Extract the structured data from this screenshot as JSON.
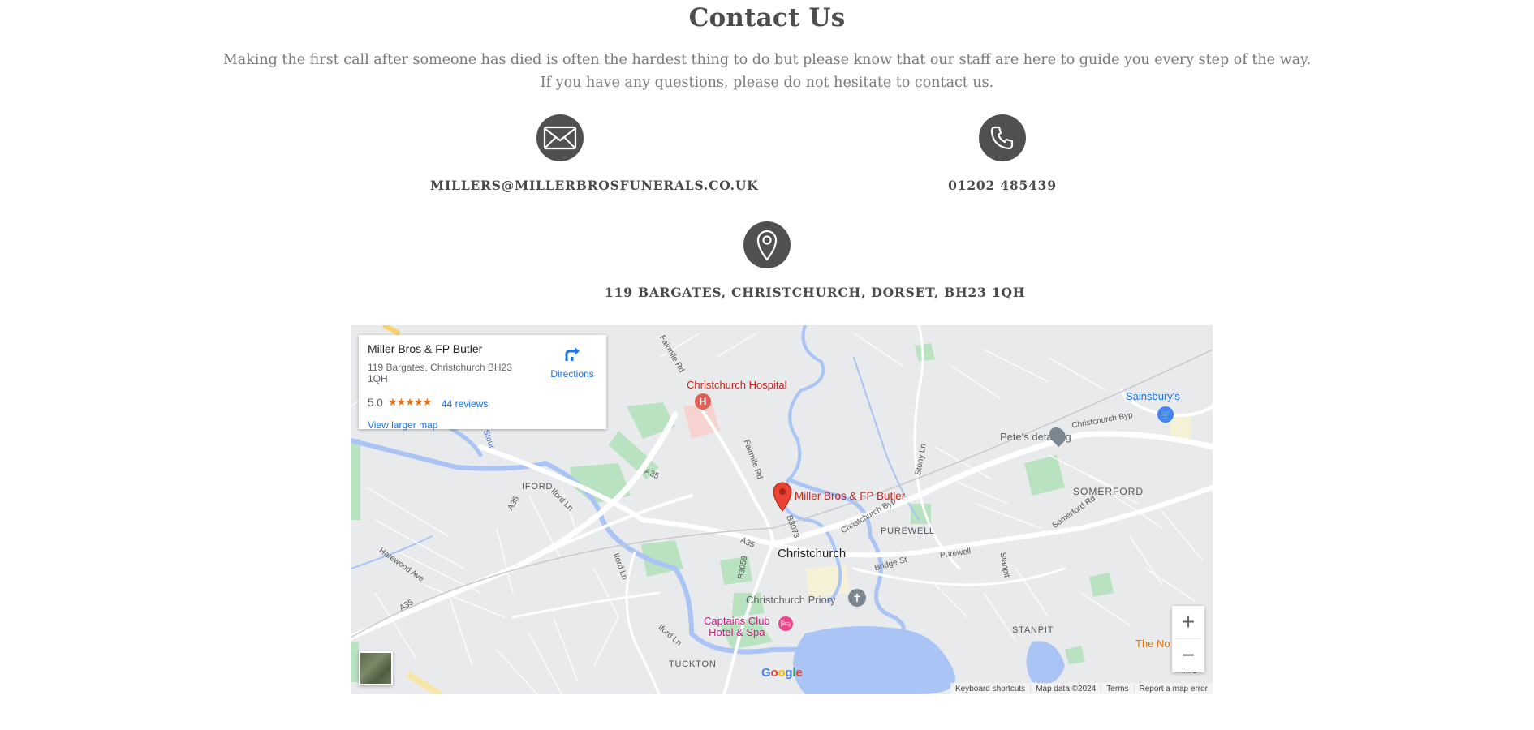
{
  "page": {
    "heading": "Contact Us",
    "intro_line1": "Making the first call after someone has died is often the hardest thing to do but please know that our staff are here to guide you every step of the way.",
    "intro_line2": "If you have any questions, please do not hesitate to contact us."
  },
  "contact": {
    "email": "MILLERS@MILLERBROSFUNERALS.CO.UK",
    "phone": "01202 485439",
    "address": "119 BARGATES, CHRISTCHURCH, DORSET, BH23 1QH",
    "email_icon": "envelope-icon",
    "phone_icon": "phone-icon",
    "address_icon": "map-pin-icon"
  },
  "map": {
    "card": {
      "title": "Miller Bros & FP Butler",
      "address": "119 Bargates, Christchurch BH23 1QH",
      "rating": "5.0",
      "stars": "★★★★★",
      "reviews": "44 reviews",
      "larger_map": "View larger map",
      "directions": "Directions"
    },
    "labels": {
      "hospital": "Christchurch Hospital",
      "marker": "Miller Bros & FP Butler",
      "sainsburys": "Sainsbury's",
      "petes": "Pete's detailing",
      "somerford": "SOMERFORD",
      "iford": "IFORD",
      "purewell": "PUREWELL",
      "christchurch": "Christchurch",
      "priory": "Christchurch Priory",
      "captains1": "Captains Club",
      "captains2": "Hotel & Spa",
      "stanpit": "STANPIT",
      "tuckton": "TUCKTON",
      "noth": "The No",
      "mu": "MU",
      "a35a": "A35",
      "a35b": "A35",
      "a35c": "A35",
      "a35d": "A35",
      "b3073": "B3073",
      "b3059": "B3059",
      "fairmile1": "Fairmile Rd",
      "fairmile2": "Fairmile Rd",
      "iford_ln1": "Iford Ln",
      "iford_ln2": "Iford Ln",
      "iford_ln3": "Iford Ln",
      "harewood": "Harewood Ave",
      "christchurch_byp1": "Christchurch Byp",
      "christchurch_byp2": "Christchurch Byp",
      "somerford_rd": "Somerford Rd",
      "bridge_st": "Bridge St",
      "purewell_rd": "Purewell",
      "stanpit_rd": "Stanpit",
      "stony_ln": "Stony Ln",
      "stour": "Stour"
    },
    "zoom_in": "+",
    "zoom_out": "−",
    "google": [
      "G",
      "o",
      "o",
      "g",
      "l",
      "e"
    ],
    "google_colors": [
      "#4285F4",
      "#EA4335",
      "#FBBC05",
      "#4285F4",
      "#34A853",
      "#EA4335"
    ],
    "attribution": {
      "shortcuts": "Keyboard shortcuts",
      "data": "Map data ©2024",
      "terms": "Terms",
      "report": "Report a map error"
    },
    "colors": {
      "water": "#aac4f5",
      "park": "#a8d9b0",
      "road": "#ffffff",
      "land": "#e9eaec",
      "marker": "#ea4335",
      "label_red": "#c5221f"
    }
  }
}
